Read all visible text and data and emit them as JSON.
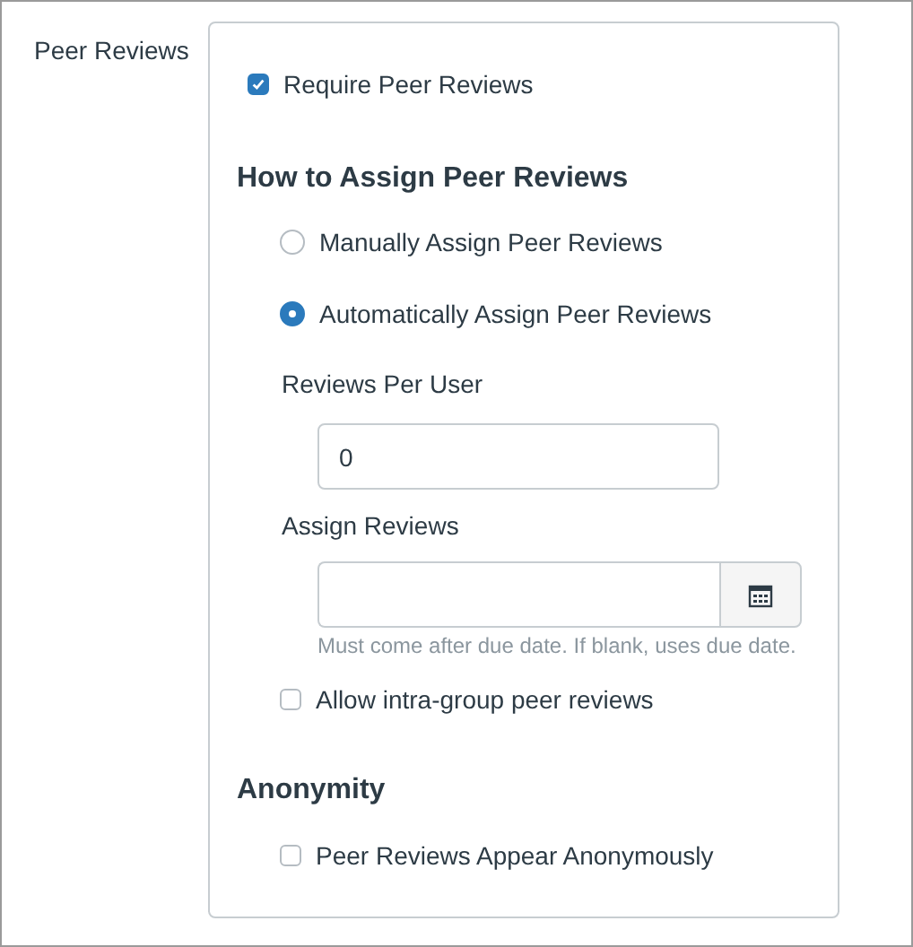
{
  "section_label": "Peer Reviews",
  "require": {
    "label": "Require Peer Reviews",
    "checked": true
  },
  "assign": {
    "heading": "How to Assign Peer Reviews",
    "options": [
      {
        "label": "Manually Assign Peer Reviews",
        "selected": false
      },
      {
        "label": "Automatically Assign Peer Reviews",
        "selected": true
      }
    ]
  },
  "reviews_per_user": {
    "label": "Reviews Per User",
    "value": "0"
  },
  "assign_reviews": {
    "label": "Assign Reviews",
    "hint": "Must come after due date. If blank, uses due date."
  },
  "intra_group": {
    "label": "Allow intra-group peer reviews",
    "checked": false
  },
  "anonymity": {
    "heading": "Anonymity",
    "option": {
      "label": "Peer Reviews Appear Anonymously",
      "checked": false
    }
  }
}
